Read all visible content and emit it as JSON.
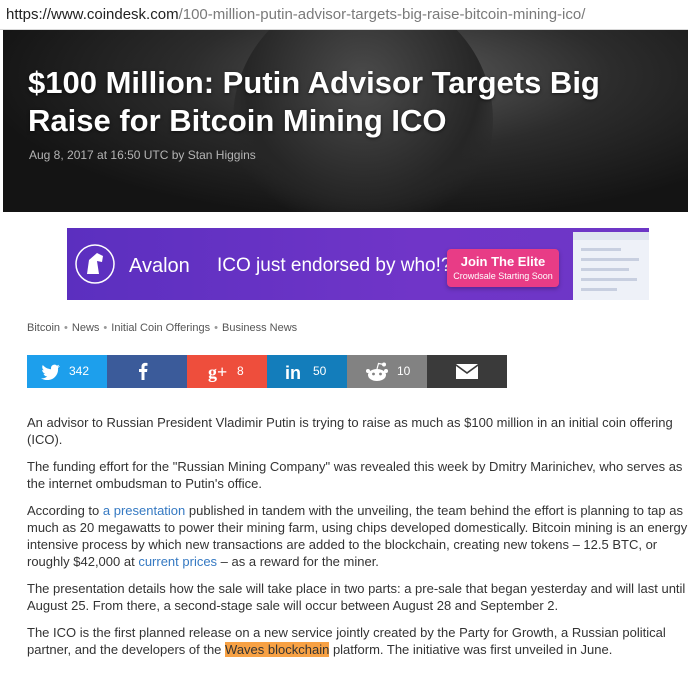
{
  "browser": {
    "url_host": "https://www.coindesk.com",
    "url_path": "/100-million-putin-advisor-targets-big-raise-bitcoin-mining-ico/"
  },
  "hero": {
    "title": "$100 Million: Putin Advisor Targets Big Raise for Bitcoin Mining ICO",
    "byline": "Aug 8, 2017 at 16:50 UTC by Stan Higgins"
  },
  "ad": {
    "brand": "Avalon",
    "tagline": "ICO just endorsed by who!?",
    "button_label": "Join The Elite",
    "button_sub": "Crowdsale Starting Soon",
    "background_color": "#6a34c6",
    "button_color": "#e83c86"
  },
  "breadcrumbs": [
    "Bitcoin",
    "News",
    "Initial Coin Offerings",
    "Business News"
  ],
  "share": [
    {
      "name": "twitter",
      "icon": "twitter-icon",
      "count": "342",
      "color": "#1d9fec"
    },
    {
      "name": "facebook",
      "icon": "facebook-icon",
      "count": "",
      "color": "#3b5b9a"
    },
    {
      "name": "google-plus",
      "icon": "google-plus-icon",
      "count": "8",
      "color": "#ee4e3c"
    },
    {
      "name": "linkedin",
      "icon": "linkedin-icon",
      "count": "50",
      "color": "#137dbb"
    },
    {
      "name": "reddit",
      "icon": "reddit-icon",
      "count": "10",
      "color": "#828282"
    },
    {
      "name": "email",
      "icon": "mail-icon",
      "count": "",
      "color": "#3a3a3a"
    }
  ],
  "article": {
    "p1": "An advisor to Russian President Vladimir Putin is trying to raise as much as $100 million in an initial coin offering (ICO).",
    "p2": "The funding effort for the \"Russian Mining Company\" was revealed this week by Dmitry Marinichev, who serves as the internet ombudsman to Putin's office.",
    "p3_a": "According to ",
    "p3_link1": "a presentation",
    "p3_b": " published in tandem with the unveiling, the team behind the effort is planning to tap as much as 20 megawatts to power their mining farm, using chips developed domestically. Bitcoin mining is an energy intensive process by which new transactions are added to the blockchain, creating new tokens – 12.5 BTC, or roughly $42,000 at ",
    "p3_link2": "current prices",
    "p3_c": " – as a reward for the miner.",
    "p4": "The presentation details how the sale will take place in two parts: a pre-sale that began yesterday and will last until August 25. From there, a second-stage sale will occur between August 28 and September 2.",
    "p5_a": "The ICO is the first planned release on a new service jointly created by the Party for Growth, a Russian political partner, and the developers of the ",
    "p5_highlight": "Waves blockchain",
    "p5_b": " platform. The initiative was first unveiled in June."
  }
}
